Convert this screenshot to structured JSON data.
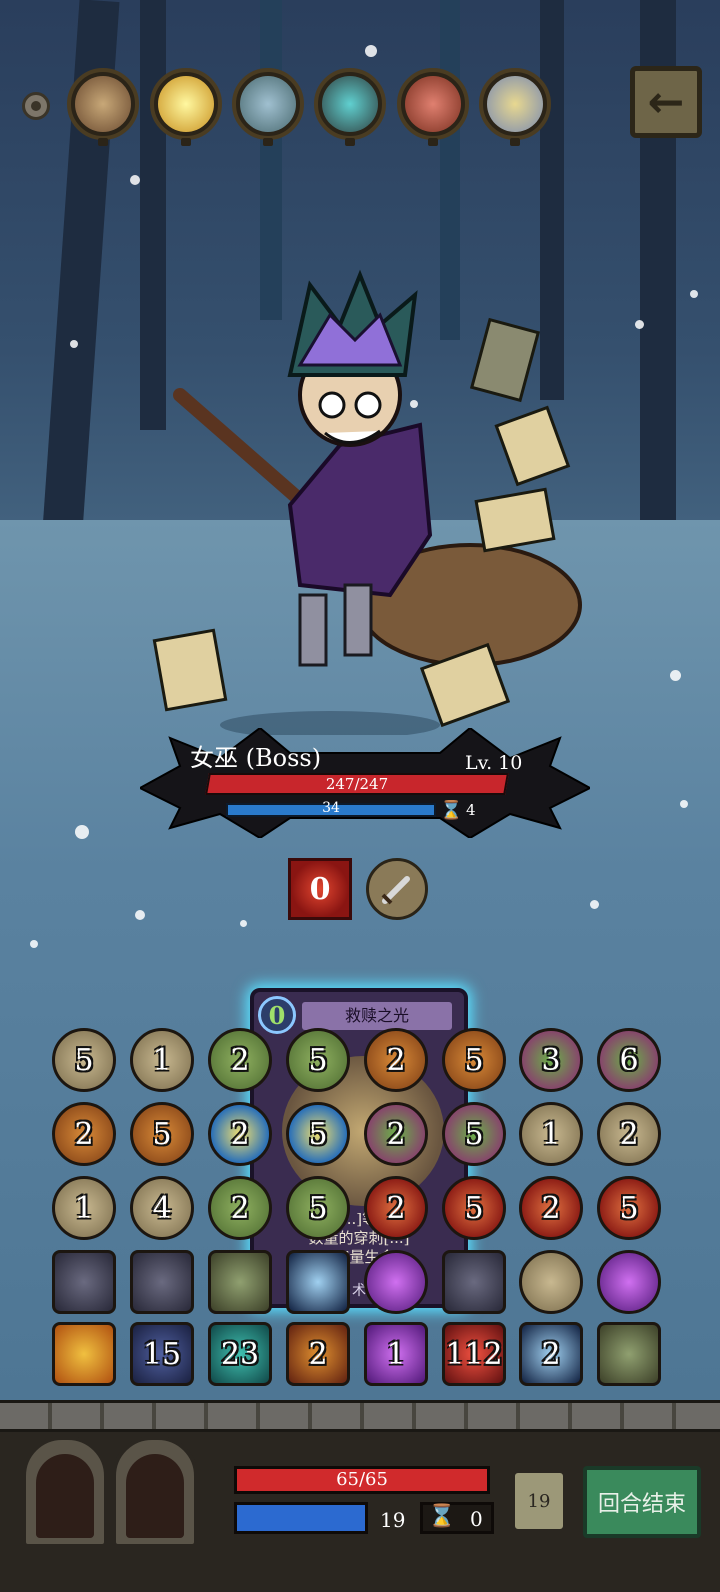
{
  "boss": {
    "name": "女巫 (Boss)",
    "level": "Lv. 10",
    "hp": "247/247",
    "shield": "34",
    "turns": "4",
    "intent_value": "0"
  },
  "card": {
    "cost": "0",
    "title": "救赎之光",
    "desc_line1": "多[...]等    悔",
    "desc_line2": "数量的穿刺[...]",
    "desc_line3": "[...]量生命",
    "type": "术"
  },
  "grid": {
    "row1": [
      "5",
      "1",
      "2",
      "5",
      "2",
      "5",
      "3",
      "6"
    ],
    "row2": [
      "2",
      "5",
      "2",
      "5",
      "2",
      "5",
      "1",
      "2"
    ],
    "row3": [
      "1",
      "4",
      "2",
      "5",
      "2",
      "5",
      "2",
      "5"
    ],
    "row5": [
      "",
      "15",
      "23",
      "2",
      "1",
      "112",
      "2",
      ""
    ]
  },
  "player": {
    "hp": "65/65",
    "shield": "19",
    "hourglass": "0",
    "deck_count": "19"
  },
  "buttons": {
    "end_turn": "回合结束"
  }
}
